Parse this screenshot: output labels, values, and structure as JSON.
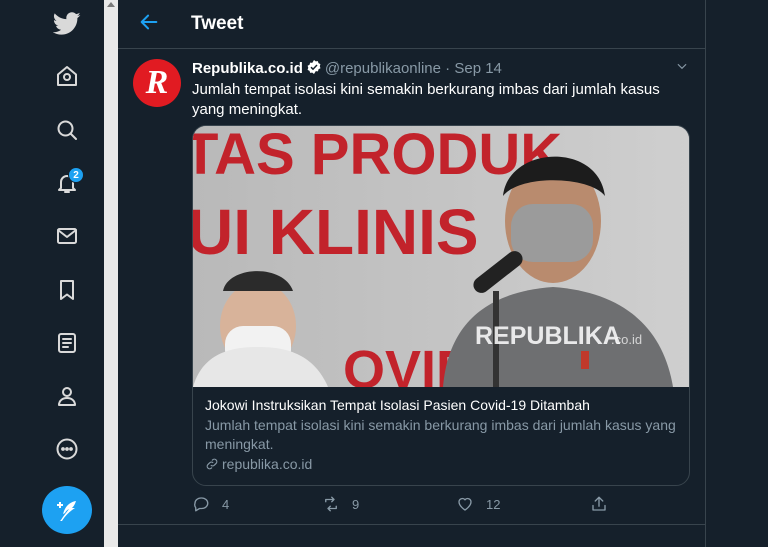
{
  "notifications": {
    "count": "2"
  },
  "header": {
    "title": "Tweet"
  },
  "tweet": {
    "author_name": "Republika.co.id",
    "avatar_letter": "R",
    "handle": "@republikaonline",
    "separator": "·",
    "date": "Sep 14",
    "text": "Jumlah tempat isolasi kini semakin berkurang imbas dari jumlah kasus yang meningkat.",
    "card": {
      "image_banner_line1": "TAS PRODUK",
      "image_banner_line2": "UI KLINIS",
      "image_banner_line3": "OVID",
      "image_watermark": "REPUBLIKA",
      "image_watermark_suffix": ".co.id",
      "title": "Jokowi Instruksikan Tempat Isolasi Pasien Covid-19 Ditambah",
      "description": "Jumlah tempat isolasi kini semakin berkurang imbas dari jumlah kasus yang meningkat.",
      "domain": "republika.co.id"
    },
    "actions": {
      "replies": "4",
      "retweets": "9",
      "likes": "12"
    }
  },
  "colors": {
    "accent": "#1da1f2",
    "background": "#15202b",
    "border": "#38444d",
    "muted": "#8899a6",
    "brand_red": "#e11b22"
  }
}
